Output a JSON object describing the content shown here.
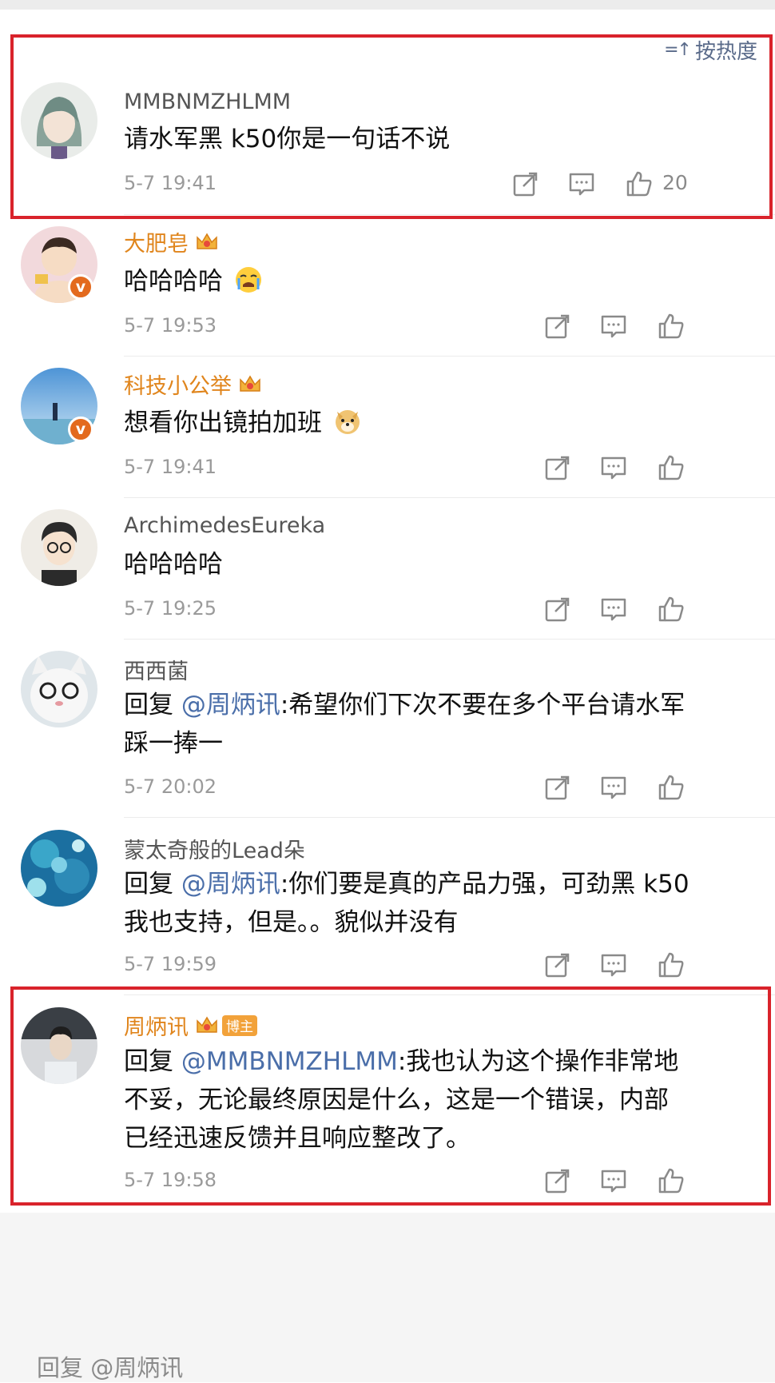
{
  "sort_label": "按热度",
  "comments": [
    {
      "user": "MMBNMZHLMM",
      "lines": [
        [
          "请水军黑 k50你是一句话不说"
        ]
      ],
      "time": "5-7 19:41",
      "likes": "20"
    },
    {
      "user": "大肥皂",
      "lines": [
        [
          "哈哈哈哈"
        ]
      ],
      "time": "5-7 19:53",
      "likes": ""
    },
    {
      "user": "科技小公举",
      "lines": [
        [
          "想看你出镜拍加班"
        ]
      ],
      "time": "5-7 19:41",
      "likes": ""
    },
    {
      "user": "ArchimedesEureka",
      "lines": [
        [
          "哈哈哈哈"
        ]
      ],
      "time": "5-7 19:25",
      "likes": ""
    },
    {
      "user": "西西菌",
      "lines": [
        [
          "回复 ",
          "@周炳讯",
          ":希望你们下次不要在多个平台请水军"
        ],
        [
          "踩一捧一"
        ]
      ],
      "time": "5-7 20:02",
      "likes": ""
    },
    {
      "user": "蒙太奇般的Lead朵",
      "lines": [
        [
          "回复 ",
          "@周炳讯",
          ":你们要是真的产品力强，可劲黑 k50"
        ],
        [
          "我也支持，但是。。貌似并没有"
        ]
      ],
      "time": "5-7 19:59",
      "likes": ""
    },
    {
      "user": "周炳讯",
      "badge": "博主",
      "lines": [
        [
          "回复 ",
          "@MMBNMZHLMM",
          ":我也认为这个操作非常地"
        ],
        [
          "不妥，无论最终原因是什么，这是一个错误，内部"
        ],
        [
          "已经迅速反馈并且响应整改了。"
        ]
      ],
      "time": "5-7 19:58",
      "likes": ""
    }
  ],
  "reply_placeholder": "回复 @周炳讯",
  "colors": {
    "highlight": "#d9232b",
    "mention": "#4a6ea9",
    "vip_name": "#e0851c",
    "verified": "#e36a1e"
  },
  "icons": [
    "share-icon",
    "comment-icon",
    "like-icon",
    "crown-icon",
    "verified-icon",
    "crying-emoji",
    "doge-emoji"
  ]
}
